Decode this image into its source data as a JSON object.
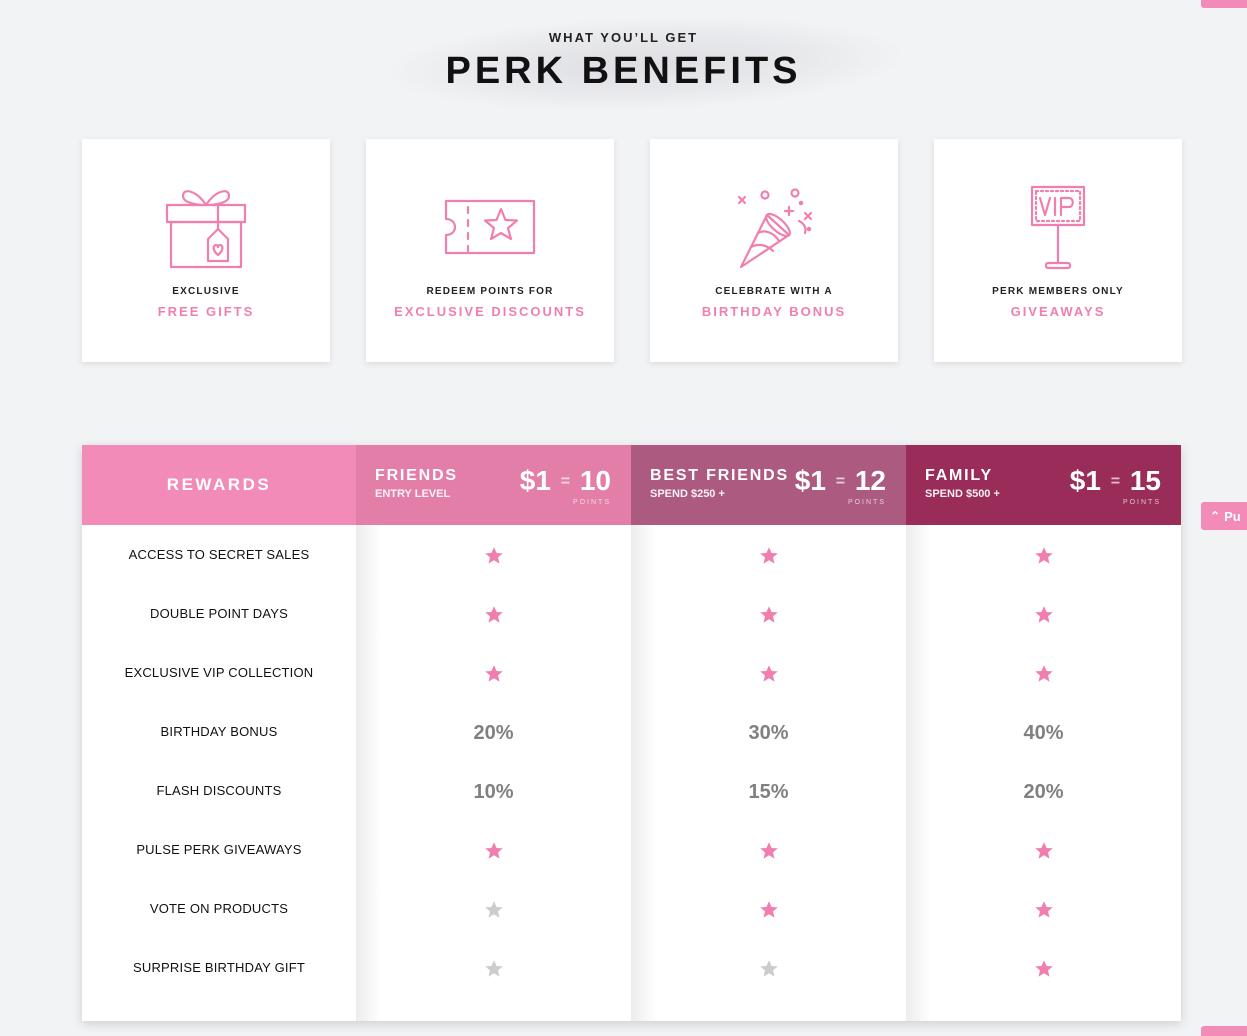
{
  "header": {
    "eyebrow": "WHAT YOU’LL GET",
    "title": "PERK BENEFITS"
  },
  "colors": {
    "pink": "#f07fb0",
    "tier_friends": "#e37ea9",
    "tier_best_friends": "#ad5a80",
    "tier_family": "#992c59",
    "rewards_header": "#f38bb8",
    "star_on": "#f07fb0",
    "star_off": "#cccccc"
  },
  "benefits": [
    {
      "icon": "gift-icon",
      "pre": "EXCLUSIVE",
      "highlight": "FREE GIFTS"
    },
    {
      "icon": "ticket-star-icon",
      "pre": "REDEEM POINTS FOR",
      "highlight": "EXCLUSIVE DISCOUNTS"
    },
    {
      "icon": "party-popper-icon",
      "pre": "CELEBRATE WITH A",
      "highlight": "BIRTHDAY BONUS"
    },
    {
      "icon": "vip-sign-icon",
      "pre": "PERK MEMBERS ONLY",
      "highlight": "GIVEAWAYS"
    }
  ],
  "table": {
    "rewards_header": "REWARDS",
    "tiers": [
      {
        "name": "FRIENDS",
        "sub": "ENTRY LEVEL",
        "rate_dollar": "$1",
        "rate_eq": "=",
        "rate_points": "10",
        "points_label": "POINTS"
      },
      {
        "name": "BEST FRIENDS",
        "sub": "SPEND $250 +",
        "rate_dollar": "$1",
        "rate_eq": "=",
        "rate_points": "12",
        "points_label": "POINTS"
      },
      {
        "name": "FAMILY",
        "sub": "SPEND $500 +",
        "rate_dollar": "$1",
        "rate_eq": "=",
        "rate_points": "15",
        "points_label": "POINTS"
      }
    ],
    "rows": [
      {
        "label": "ACCESS TO SECRET SALES",
        "values": [
          "star",
          "star",
          "star"
        ]
      },
      {
        "label": "DOUBLE POINT DAYS",
        "values": [
          "star",
          "star",
          "star"
        ]
      },
      {
        "label": "EXCLUSIVE VIP COLLECTION",
        "values": [
          "star",
          "star",
          "star"
        ]
      },
      {
        "label": "BIRTHDAY BONUS",
        "values": [
          "20%",
          "30%",
          "40%"
        ]
      },
      {
        "label": "FLASH DISCOUNTS",
        "values": [
          "10%",
          "15%",
          "20%"
        ]
      },
      {
        "label": "PULSE PERK GIVEAWAYS",
        "values": [
          "star",
          "star",
          "star"
        ]
      },
      {
        "label": "VOTE ON PRODUCTS",
        "values": [
          "star-off",
          "star",
          "star"
        ]
      },
      {
        "label": "SURPRISE BIRTHDAY GIFT",
        "values": [
          "star-off",
          "star-off",
          "star"
        ]
      }
    ]
  },
  "side_tab": {
    "icon": "chevron-up-icon",
    "label": "Pu"
  }
}
